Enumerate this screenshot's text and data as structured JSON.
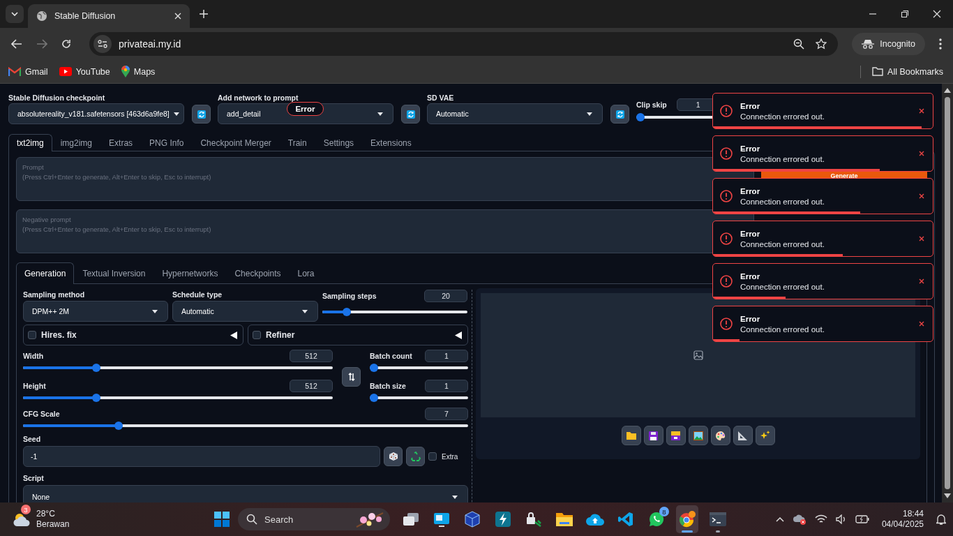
{
  "browser": {
    "tab_title": "Stable Diffusion",
    "url": "privateai.my.id",
    "profile": "Incognito",
    "bookmarks": [
      {
        "kind": "mail",
        "label": "Gmail"
      },
      {
        "kind": "video",
        "label": "YouTube"
      },
      {
        "kind": "map",
        "label": "Maps"
      }
    ],
    "all_bookmarks": "All Bookmarks"
  },
  "top_settings": {
    "checkpoint": {
      "label": "Stable Diffusion checkpoint",
      "value": "absolutereality_v181.safetensors [463d6a9fe8]"
    },
    "network": {
      "label": "Add network to prompt",
      "value": "add_detail"
    },
    "vae": {
      "label": "SD VAE",
      "value": "Automatic"
    },
    "clip_skip": {
      "label": "Clip skip",
      "value": "1",
      "level": 0
    }
  },
  "error_pill": "Error",
  "main_tabs": [
    {
      "label": "txt2img",
      "selected": true
    },
    {
      "label": "img2img",
      "selected": false
    },
    {
      "label": "Extras",
      "selected": false
    },
    {
      "label": "PNG Info",
      "selected": false
    },
    {
      "label": "Checkpoint Merger",
      "selected": false
    },
    {
      "label": "Train",
      "selected": false
    },
    {
      "label": "Settings",
      "selected": false
    },
    {
      "label": "Extensions",
      "selected": false
    }
  ],
  "prompt": {
    "label": "Prompt",
    "placeholder": "(Press Ctrl+Enter to generate, Alt+Enter to skip, Esc to interrupt)"
  },
  "negative_prompt": {
    "label": "Negative prompt",
    "placeholder": "(Press Ctrl+Enter to generate, Alt+Enter to skip, Esc to interrupt)"
  },
  "generate_button": "Generate",
  "sub_tabs": [
    {
      "label": "Generation",
      "selected": true
    },
    {
      "label": "Textual Inversion",
      "selected": false
    },
    {
      "label": "Hypernetworks",
      "selected": false
    },
    {
      "label": "Checkpoints",
      "selected": false
    },
    {
      "label": "Lora",
      "selected": false
    }
  ],
  "generation": {
    "sampling_method": {
      "label": "Sampling method",
      "value": "DPM++ 2M"
    },
    "schedule_type": {
      "label": "Schedule type",
      "value": "Automatic"
    },
    "sampling_steps": {
      "label": "Sampling steps",
      "value": "20",
      "level": 0.15
    },
    "accordions": [
      {
        "label": "Hires. fix",
        "checked": false
      },
      {
        "label": "Refiner",
        "checked": false
      }
    ],
    "width": {
      "label": "Width",
      "value": "512",
      "level": 0.23
    },
    "height": {
      "label": "Height",
      "value": "512",
      "level": 0.23
    },
    "batch_count": {
      "label": "Batch count",
      "value": "1",
      "level": 0
    },
    "batch_size": {
      "label": "Batch size",
      "value": "1",
      "level": 0
    },
    "cfg_scale": {
      "label": "CFG Scale",
      "value": "7",
      "level": 0.21
    },
    "seed": {
      "label": "Seed",
      "value": "-1"
    },
    "extra": {
      "label": "Extra",
      "checked": false
    },
    "script": {
      "label": "Script",
      "value": "None"
    }
  },
  "toasts": [
    {
      "title": "Error",
      "message": "Connection errored out.",
      "level": 0.95
    },
    {
      "title": "Error",
      "message": "Connection errored out.",
      "level": 0.76
    },
    {
      "title": "Error",
      "message": "Connection errored out.",
      "level": 0.67
    },
    {
      "title": "Error",
      "message": "Connection errored out.",
      "level": 0.59
    },
    {
      "title": "Error",
      "message": "Connection errored out.",
      "level": 0.33
    },
    {
      "title": "Error",
      "message": "Connection errored out.",
      "level": 0.12
    }
  ],
  "taskbar": {
    "weather": {
      "badge": "3",
      "temp": "28°C",
      "condition": "Berawan"
    },
    "search": "Search",
    "apps": [
      {
        "kind": "task-view",
        "selected": false,
        "running": false
      },
      {
        "kind": "monitor",
        "selected": false,
        "running": false
      },
      {
        "kind": "cube",
        "selected": false,
        "running": false
      },
      {
        "kind": "bolt",
        "selected": false,
        "running": false
      },
      {
        "kind": "lock",
        "selected": false,
        "running": false
      },
      {
        "kind": "folder",
        "selected": false,
        "running": false
      },
      {
        "kind": "cloud",
        "selected": false,
        "running": false
      },
      {
        "kind": "code",
        "selected": false,
        "running": false
      },
      {
        "kind": "chat",
        "selected": false,
        "running": false,
        "badge": "8"
      },
      {
        "kind": "browser",
        "selected": true,
        "running": true
      },
      {
        "kind": "terminal",
        "selected": false,
        "running": true
      }
    ],
    "time": "18:44",
    "date": "04/04/2025"
  }
}
